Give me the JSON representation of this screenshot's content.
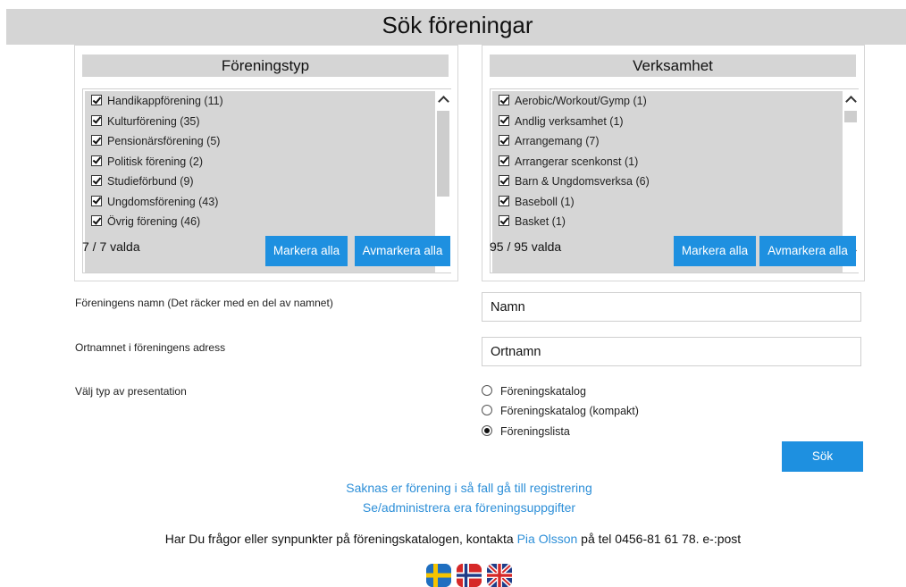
{
  "header": {
    "title": "Sök föreningar"
  },
  "type_panel": {
    "title": "Föreningstyp",
    "items": [
      {
        "label": "Handikappförening (11)"
      },
      {
        "label": "Kulturförening (35)"
      },
      {
        "label": "Pensionärsförening (5)"
      },
      {
        "label": "Politisk förening (2)"
      },
      {
        "label": "Studieförbund (9)"
      },
      {
        "label": "Ungdomsförening (43)"
      },
      {
        "label": "Övrig förening (46)"
      }
    ],
    "count": "7 / 7 valda",
    "select_all": "Markera alla",
    "deselect_all": "Avmarkera alla"
  },
  "activity_panel": {
    "title": "Verksamhet",
    "items": [
      {
        "label": "Aerobic/Workout/Gymp (1)"
      },
      {
        "label": "Andlig verksamhet (1)"
      },
      {
        "label": "Arrangemang (7)"
      },
      {
        "label": "Arrangerar scenkonst (1)"
      },
      {
        "label": "Barn & Ungdomsverksa (6)"
      },
      {
        "label": "Baseboll (1)"
      },
      {
        "label": "Basket (1)"
      }
    ],
    "count": "95 / 95 valda",
    "select_all": "Markera alla",
    "deselect_all": "Avmarkera alla"
  },
  "form": {
    "name_label": "Föreningens namn (Det räcker med en del av namnet)",
    "name_placeholder": "Namn",
    "city_label": "Ortnamnet i föreningens adress",
    "city_placeholder": "Ortnamn",
    "presentation_label": "Välj typ av presentation",
    "presentation_options": [
      {
        "label": "Föreningskatalog",
        "selected": false
      },
      {
        "label": "Föreningskatalog (kompakt)",
        "selected": false
      },
      {
        "label": "Föreningslista",
        "selected": true
      }
    ],
    "search_button": "Sök"
  },
  "links": {
    "register": "Saknas er förening i så fall gå till registrering",
    "manage": "Se/administrera era föreningsuppgifter"
  },
  "footer": {
    "text_before": "Har Du frågor eller synpunkter på föreningskatalogen, kontakta ",
    "contact_name": "Pia Olsson",
    "text_after": " på tel 0456-81 61 78. e-:post"
  },
  "languages": [
    {
      "icon": "swedish-flag-icon"
    },
    {
      "icon": "norwegian-flag-icon"
    },
    {
      "icon": "uk-flag-icon"
    }
  ],
  "colors": {
    "accent": "#1e90e0",
    "link": "#2d8fd8",
    "panel_header": "#d5d5d5"
  }
}
